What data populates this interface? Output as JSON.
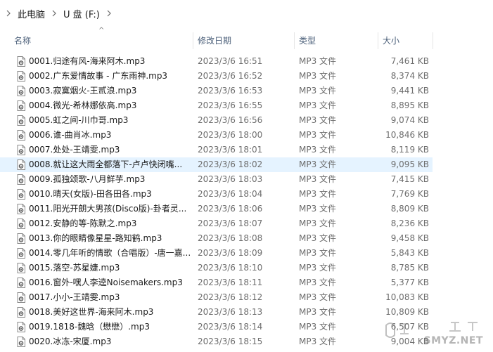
{
  "breadcrumb": {
    "items": [
      "此电脑",
      "U 盘 (F:)"
    ]
  },
  "columns": {
    "name": "名称",
    "date": "修改日期",
    "type": "类型",
    "size": "大小"
  },
  "sort_indicator": "^",
  "files": [
    {
      "name": "0001.归途有风-海来阿木.mp3",
      "date": "2023/3/6 16:51",
      "type": "MP3 文件",
      "size": "7,461 KB"
    },
    {
      "name": "0002.广东爱情故事 - 广东雨神.mp3",
      "date": "2023/3/6 16:52",
      "type": "MP3 文件",
      "size": "8,374 KB"
    },
    {
      "name": "0003.寂寞烟火-王贰浪.mp3",
      "date": "2023/3/6 16:53",
      "type": "MP3 文件",
      "size": "9,441 KB"
    },
    {
      "name": "0004.微光-希林娜依高.mp3",
      "date": "2023/3/6 16:55",
      "type": "MP3 文件",
      "size": "8,895 KB"
    },
    {
      "name": "0005.虹之间-川巾哥.mp3",
      "date": "2023/3/6 16:56",
      "type": "MP3 文件",
      "size": "9,074 KB"
    },
    {
      "name": "0006.谁-曲肖冰.mp3",
      "date": "2023/3/6 18:00",
      "type": "MP3 文件",
      "size": "10,846 KB"
    },
    {
      "name": "0007.处处-王靖雯.mp3",
      "date": "2023/3/6 18:01",
      "type": "MP3 文件",
      "size": "8,119 KB"
    },
    {
      "name": "0008.就让这大雨全都落下-卢卢快闭嘴...",
      "date": "2023/3/6 18:02",
      "type": "MP3 文件",
      "size": "9,095 KB"
    },
    {
      "name": "0009.孤独颂歌-八月鲜芋.mp3",
      "date": "2023/3/6 18:03",
      "type": "MP3 文件",
      "size": "7,415 KB"
    },
    {
      "name": "0010.晴天(女版)-田各田各.mp3",
      "date": "2023/3/6 18:04",
      "type": "MP3 文件",
      "size": "7,769 KB"
    },
    {
      "name": "0011.阳光开朗大男孩(Disco版)-卦者灵...",
      "date": "2023/3/6 18:06",
      "type": "MP3 文件",
      "size": "8,809 KB"
    },
    {
      "name": "0012.安静的等-陈默之.mp3",
      "date": "2023/3/6 18:07",
      "type": "MP3 文件",
      "size": "8,236 KB"
    },
    {
      "name": "0013.你的眼睛像星星-路知鹤.mp3",
      "date": "2023/3/6 18:08",
      "type": "MP3 文件",
      "size": "9,458 KB"
    },
    {
      "name": "0014.零几年听的情歌（合唱版）-唐一嘉...",
      "date": "2023/3/6 18:09",
      "type": "MP3 文件",
      "size": "5,843 KB"
    },
    {
      "name": "0015.落空-苏星婕.mp3",
      "date": "2023/3/6 18:10",
      "type": "MP3 文件",
      "size": "8,785 KB"
    },
    {
      "name": "0016.窗外-嘿人李逵Noisemakers.mp3",
      "date": "2023/3/6 18:11",
      "type": "MP3 文件",
      "size": "5,377 KB"
    },
    {
      "name": "0017.小小-王靖雯.mp3",
      "date": "2023/3/6 18:12",
      "type": "MP3 文件",
      "size": "10,083 KB"
    },
    {
      "name": "0018.美好这世界-海来阿木.mp3",
      "date": "2023/3/6 18:13",
      "type": "MP3 文件",
      "size": "10,809 KB"
    },
    {
      "name": "0019.1818-魏晗（懋懋）.mp3",
      "date": "2023/3/6 18:14",
      "type": "MP3 文件",
      "size": "6,507 KB"
    },
    {
      "name": "0020.冰冻-宋厦.mp3",
      "date": "2023/3/6 18:15",
      "type": "MP3 文件",
      "size": "9,004 KB"
    }
  ],
  "hovered_row": 7,
  "watermark": {
    "text": "SMYZ.NET"
  },
  "colors": {
    "hover": "#e5f3ff",
    "header_text": "#4c607a",
    "meta_text": "#6d6d6d"
  }
}
